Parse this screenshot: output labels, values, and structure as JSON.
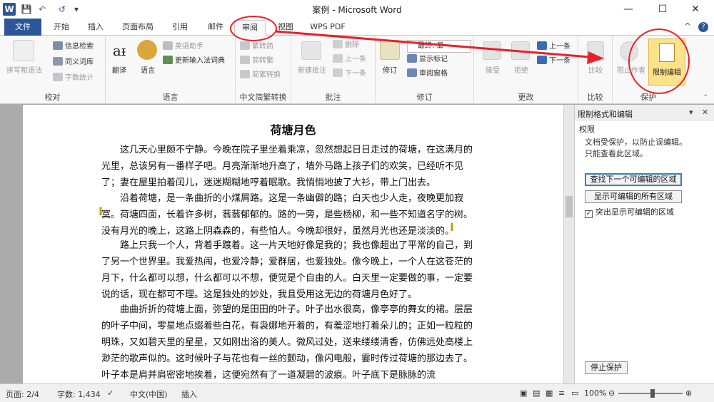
{
  "window": {
    "title": "案例 - Microsoft Word",
    "app_icon": "W",
    "controls": {
      "minimize": "—",
      "maximize": "☐",
      "close": "✕"
    }
  },
  "qat": {
    "save": "💾",
    "undo": "↶",
    "redo": "↺",
    "more": "▾"
  },
  "tabs": [
    "文件",
    "开始",
    "插入",
    "页面布局",
    "引用",
    "邮件",
    "审阅",
    "视图",
    "WPS PDF"
  ],
  "tabs_right": {
    "collapse": "^",
    "help": "?"
  },
  "ribbon": {
    "proofing": {
      "label": "校对",
      "spell": "拼写和语法",
      "research": "信息检索",
      "thesaurus": "同义词库",
      "wordcount": "字数统计"
    },
    "language": {
      "label": "语言",
      "translate": "翻译",
      "language": "语言",
      "english_assist": "英语助手",
      "update_ime": "更新输入法词典"
    },
    "chinese": {
      "label": "中文简繁转换",
      "to_simp": "繁转简",
      "to_trad": "简转繁",
      "convert": "简繁转换"
    },
    "comments": {
      "label": "批注",
      "new": "新建批注",
      "delete": "删除",
      "prev": "上一条",
      "next": "下一条"
    },
    "tracking": {
      "label": "修订",
      "track": "修订",
      "markup": "最终: 显",
      "show_markup": "显示标记",
      "review_pane": "审阅窗格"
    },
    "changes": {
      "label": "更改",
      "accept": "接受",
      "reject": "拒绝",
      "prev": "上一条",
      "next": "下一条"
    },
    "compare": {
      "label": "比较",
      "compare": "比较"
    },
    "protect": {
      "label": "保护",
      "block_authors": "阻止作者",
      "restrict": "限制编辑"
    }
  },
  "document": {
    "title": "荷塘月色",
    "paragraphs": [
      "这几天心里颇不宁静。今晚在院子里坐着乘凉，忽然想起日日走过的荷塘，在这满月的光里，总该另有一番样子吧。月亮渐渐地升高了，墙外马路上孩子们的欢笑，已经听不见了；妻在屋里拍着闰儿，迷迷糊糊地哼着眠歌。我悄悄地披了大衫，带上门出去。",
      "沿着荷塘，是一条曲折的小煤屑路。这是一条幽僻的路；白天也少人走，夜晚更加寂寞。荷塘四面，长着许多树，蓊蓊郁郁的。路的一旁，是些杨柳，和一些不知道名字的树。没有月光的晚上，这路上阴森森的，有些怕人。今晚却很好，虽然月光也还是淡淡的。",
      "路上只我一个人，背着手踱着。这一片天地好像是我的；我也像超出了平常的自己，到了另一个世界里。我爱热闹，也爱冷静；爱群居，也爱独处。像今晚上，一个人在这苍茫的月下，什么都可以想，什么都可以不想，便觉是个自由的人。白天里一定要做的事，一定要说的话，现在都可不理。这是独处的妙处，我且受用这无边的荷塘月色好了。",
      "曲曲折折的荷塘上面，弥望的是田田的叶子。叶子出水很高，像亭亭的舞女的裙。层层的叶子中间，零星地点缀着些白花，有袅娜地开着的，有羞涩地打着朵儿的；正如一粒粒的明珠，又如碧天里的星星，又如刚出浴的美人。微风过处，送来缕缕清香，仿佛远处高楼上渺茫的歌声似的。这时候叶子与花也有一丝的颤动，像闪电般，霎时传过荷塘的那边去了。叶子本是肩并肩密密地挨着，这便宛然有了一道凝碧的波痕。叶子底下是脉脉的流"
    ]
  },
  "pane": {
    "title": "限制格式和编辑",
    "section": "权限",
    "msg1": "文档受保护，以防止误编辑。",
    "msg2": "只能查看此区域。",
    "btn_next_region": "查找下一个可编辑的区域",
    "btn_show_all": "显示可编辑的所有区域",
    "highlight_label": "突出显示可编辑的区域",
    "highlight_checked": true,
    "stop": "停止保护"
  },
  "status": {
    "page": "页面: 2/4",
    "words": "字数: 1,434",
    "lang": "中文(中国)",
    "mode": "插入",
    "zoom": "100%",
    "zoom_fraction": 0.5
  },
  "colors": {
    "accent": "#2B579A",
    "annotation": "#E8202A",
    "highlight": "#FCE28A"
  }
}
